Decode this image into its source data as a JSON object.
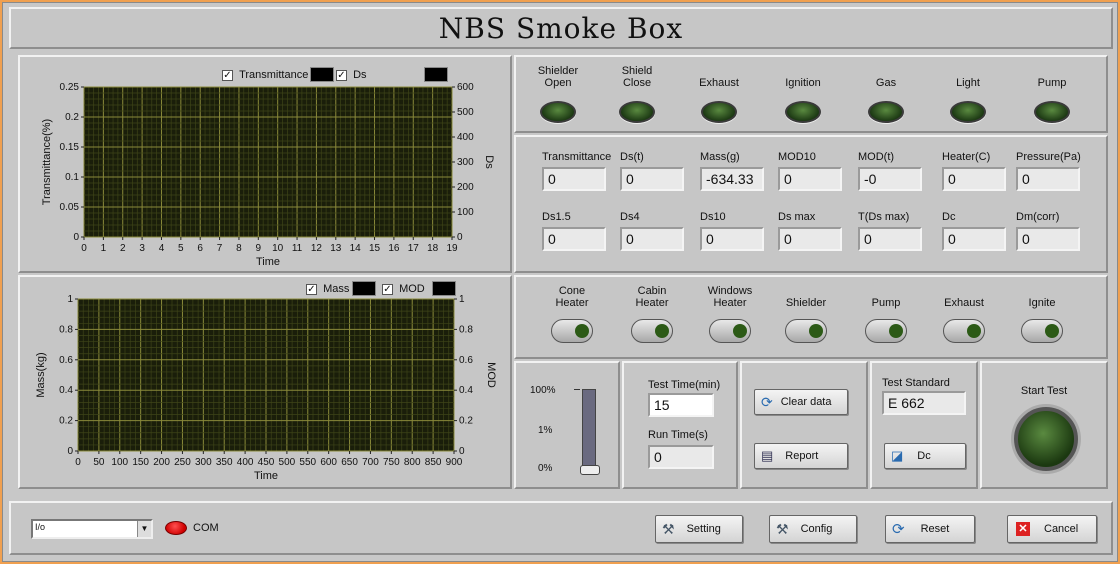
{
  "app": {
    "title": "NBS Smoke Box"
  },
  "chart_data": [
    {
      "type": "line",
      "legend": [
        "Transmittance",
        "Ds"
      ],
      "xlabel": "Time",
      "ylabel": "Transmittance(%)",
      "y2label": "Ds",
      "xlim": [
        0,
        19
      ],
      "ylim": [
        0,
        0.25
      ],
      "y2lim": [
        0,
        600
      ],
      "xticks": [
        "0",
        "1",
        "2",
        "3",
        "4",
        "5",
        "6",
        "7",
        "8",
        "9",
        "10",
        "11",
        "12",
        "13",
        "14",
        "15",
        "16",
        "17",
        "18",
        "19"
      ],
      "yticks": [
        "0.25",
        "0.2",
        "0.15",
        "0.1",
        "0.05",
        "0"
      ],
      "y2ticks": [
        "600",
        "500",
        "400",
        "300",
        "200",
        "100",
        "0"
      ],
      "series": [],
      "grid": true
    },
    {
      "type": "line",
      "legend": [
        "Mass",
        "MOD"
      ],
      "xlabel": "Time",
      "ylabel": "Mass(kg)",
      "y2label": "MOD",
      "xlim": [
        0,
        900
      ],
      "ylim": [
        0,
        1
      ],
      "y2lim": [
        0,
        1
      ],
      "xticks": [
        "0",
        "50",
        "100",
        "150",
        "200",
        "250",
        "300",
        "350",
        "400",
        "450",
        "500",
        "550",
        "600",
        "650",
        "700",
        "750",
        "800",
        "850",
        "900"
      ],
      "yticks": [
        "1",
        "0.8",
        "0.6",
        "0.4",
        "0.2",
        "0"
      ],
      "y2ticks": [
        "1",
        "0.8",
        "0.6",
        "0.4",
        "0.2",
        "0"
      ],
      "series": [],
      "grid": true
    }
  ],
  "indicators": [
    {
      "label": "Shielder\nOpen"
    },
    {
      "label": "Shield\nClose"
    },
    {
      "label": "Exhaust"
    },
    {
      "label": "Ignition"
    },
    {
      "label": "Gas"
    },
    {
      "label": "Light"
    },
    {
      "label": "Pump"
    }
  ],
  "readouts": [
    {
      "label": "Transmittance",
      "value": "0"
    },
    {
      "label": "Ds(t)",
      "value": "0"
    },
    {
      "label": "Mass(g)",
      "value": "-634.33"
    },
    {
      "label": "MOD10",
      "value": "0"
    },
    {
      "label": "MOD(t)",
      "value": "-0"
    },
    {
      "label": "Heater(C)",
      "value": "0"
    },
    {
      "label": "Pressure(Pa)",
      "value": "0"
    },
    {
      "label": "Ds1.5",
      "value": "0"
    },
    {
      "label": "Ds4",
      "value": "0"
    },
    {
      "label": "Ds10",
      "value": "0"
    },
    {
      "label": "Ds max",
      "value": "0"
    },
    {
      "label": "T(Ds max)",
      "value": "0"
    },
    {
      "label": "Dc",
      "value": "0"
    },
    {
      "label": "Dm(corr)",
      "value": "0"
    }
  ],
  "switches": [
    {
      "label": "Cone\nHeater"
    },
    {
      "label": "Cabin\nHeater"
    },
    {
      "label": "Windows\nHeater"
    },
    {
      "label": "Shielder"
    },
    {
      "label": "Pump"
    },
    {
      "label": "Exhaust"
    },
    {
      "label": "Ignite"
    }
  ],
  "slider": {
    "ticks": [
      "100%",
      "1%",
      "0%"
    ],
    "level": 0
  },
  "test": {
    "time_label": "Test Time(min)",
    "time_value": "15",
    "run_label": "Run Time(s)",
    "run_value": "0",
    "clear_label": "Clear data",
    "report_label": "Report",
    "standard_label": "Test Standard",
    "standard_value": "E 662",
    "dc_label": "Dc",
    "start_label": "Start Test"
  },
  "footer": {
    "com_value": "",
    "com_prefix": "I/o",
    "com_label": "COM",
    "setting_label": "Setting",
    "config_label": "Config",
    "reset_label": "Reset",
    "cancel_label": "Cancel"
  }
}
